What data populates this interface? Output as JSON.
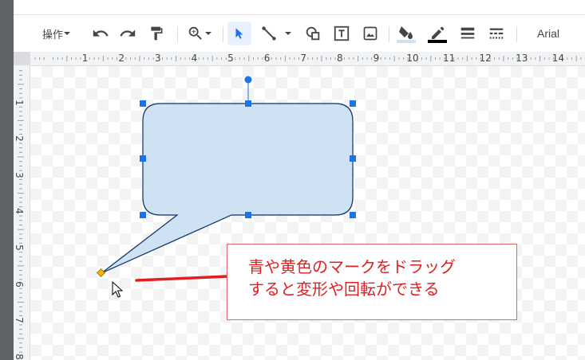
{
  "toolbar": {
    "actions_label": "操作",
    "font_name": "Arial"
  },
  "ruler": {
    "top_labels": [
      "1",
      "2",
      "3",
      "4",
      "5",
      "6",
      "7",
      "8",
      "9",
      "10",
      "11",
      "12",
      "13",
      "14"
    ],
    "left_labels": [
      "1",
      "2",
      "3",
      "4",
      "5",
      "6",
      "7",
      "8"
    ]
  },
  "annotation": {
    "line1": "青や黄色のマークをドラッグ",
    "line2": "すると変形や回転ができる"
  },
  "colors": {
    "bubble_fill": "#cfe2f3",
    "selection_blue": "#1a73e8",
    "adjust_handle": "#f4b400",
    "annotation_red": "#e02020"
  },
  "icons": [
    "undo-icon",
    "redo-icon",
    "paint-format-icon",
    "zoom-icon",
    "select-cursor-icon",
    "line-icon",
    "shape-icon",
    "text-box-icon",
    "image-icon",
    "fill-color-icon",
    "border-color-icon",
    "border-weight-icon",
    "border-dash-icon"
  ]
}
